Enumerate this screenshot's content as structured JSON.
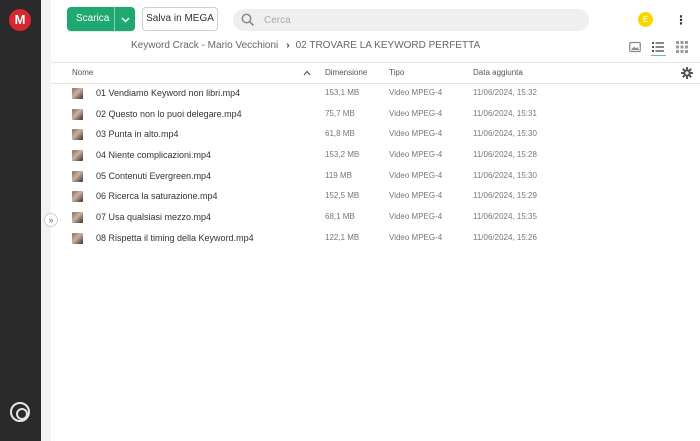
{
  "app": {
    "logo": "M"
  },
  "toolbar": {
    "download_label": "Scarica",
    "download_dropdown_icon": "chevron-down-icon",
    "save_label": "Salva in MEGA"
  },
  "search": {
    "placeholder": "Cerca",
    "value": ""
  },
  "user": {
    "avatar_initial": "E",
    "avatar_color": "#f5d800"
  },
  "breadcrumb": {
    "parent": "Keyword Crack - Mario Vecchioni",
    "separator": "›",
    "current": "02 TROVARE LA KEYWORD PERFETTA"
  },
  "sidebar": {
    "toggle_symbol": "»"
  },
  "table": {
    "headers": {
      "name": "Nome",
      "size": "Dimensione",
      "type": "Tipo",
      "date": "Data aggiunta"
    },
    "rows": [
      {
        "name": "01 Vendiamo Keyword non libri.mp4",
        "size": "153,1 MB",
        "type": "Video MPEG-4",
        "date": "11/06/2024, 15:32"
      },
      {
        "name": "02 Questo non lo puoi delegare.mp4",
        "size": "75,7 MB",
        "type": "Video MPEG-4",
        "date": "11/06/2024, 15:31"
      },
      {
        "name": "03 Punta in alto.mp4",
        "size": "61,8 MB",
        "type": "Video MPEG-4",
        "date": "11/06/2024, 15:30"
      },
      {
        "name": "04 Niente complicazioni.mp4",
        "size": "153,2 MB",
        "type": "Video MPEG-4",
        "date": "11/06/2024, 15:28"
      },
      {
        "name": "05 Contenuti Evergreen.mp4",
        "size": "119 MB",
        "type": "Video MPEG-4",
        "date": "11/06/2024, 15:30"
      },
      {
        "name": "06 Ricerca la saturazione.mp4",
        "size": "152,5 MB",
        "type": "Video MPEG-4",
        "date": "11/06/2024, 15:29"
      },
      {
        "name": "07 Usa qualsiasi mezzo.mp4",
        "size": "68,1 MB",
        "type": "Video MPEG-4",
        "date": "11/06/2024, 15:35"
      },
      {
        "name": "08 Rispetta il timing della Keyword.mp4",
        "size": "122,1 MB",
        "type": "Video MPEG-4",
        "date": "11/06/2024, 15:26"
      }
    ]
  },
  "colors": {
    "accent": "#1fa971",
    "brand": "#d9272e",
    "rail": "#2a2a2a"
  }
}
